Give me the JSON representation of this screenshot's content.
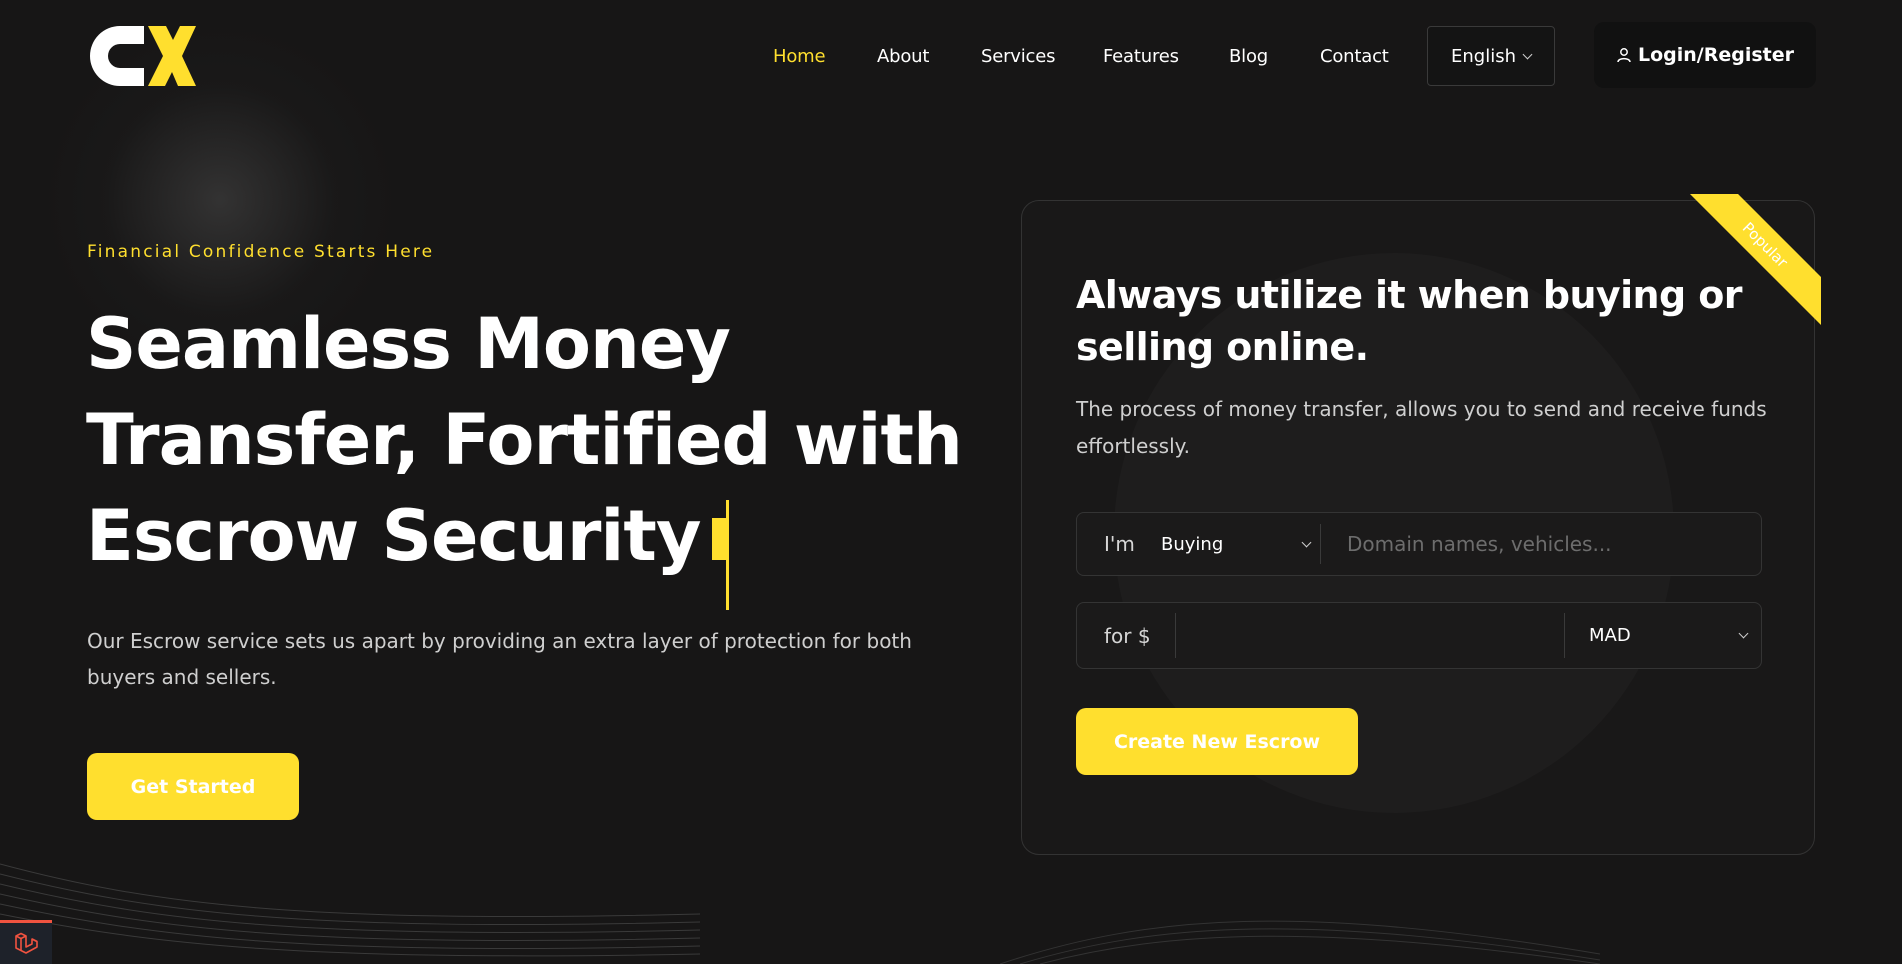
{
  "nav": {
    "items": [
      {
        "label": "Home",
        "active": true
      },
      {
        "label": "About",
        "active": false
      },
      {
        "label": "Services",
        "active": false
      },
      {
        "label": "Features",
        "active": false
      },
      {
        "label": "Blog",
        "active": false
      },
      {
        "label": "Contact",
        "active": false
      }
    ],
    "language": "English",
    "login_label": "Login/Register"
  },
  "hero": {
    "tagline": "Financial Confidence Starts Here",
    "title_lines": [
      "Seamless Money",
      "Transfer, Fortified with",
      "Escrow Security"
    ],
    "description": "Our Escrow service sets us apart by providing an extra layer of protection for both buyers and sellers.",
    "cta_label": "Get Started"
  },
  "card": {
    "ribbon": "Popular",
    "title": "Always utilize it when buying or selling online.",
    "description": "The process of money transfer, allows you to send and receive funds effortlessly.",
    "role_label": "I'm",
    "role_value": "Buying",
    "item_placeholder": "Domain names, vehicles...",
    "amount_label": "for $",
    "amount_value": "",
    "currency": "MAD",
    "submit_label": "Create New Escrow"
  },
  "colors": {
    "accent": "#ffdf2e",
    "background": "#171616",
    "text": "#ffffff",
    "muted": "#cfcfcf"
  },
  "icons": [
    "logo-icon",
    "user-icon",
    "chevron-down-icon",
    "laravel-icon"
  ]
}
